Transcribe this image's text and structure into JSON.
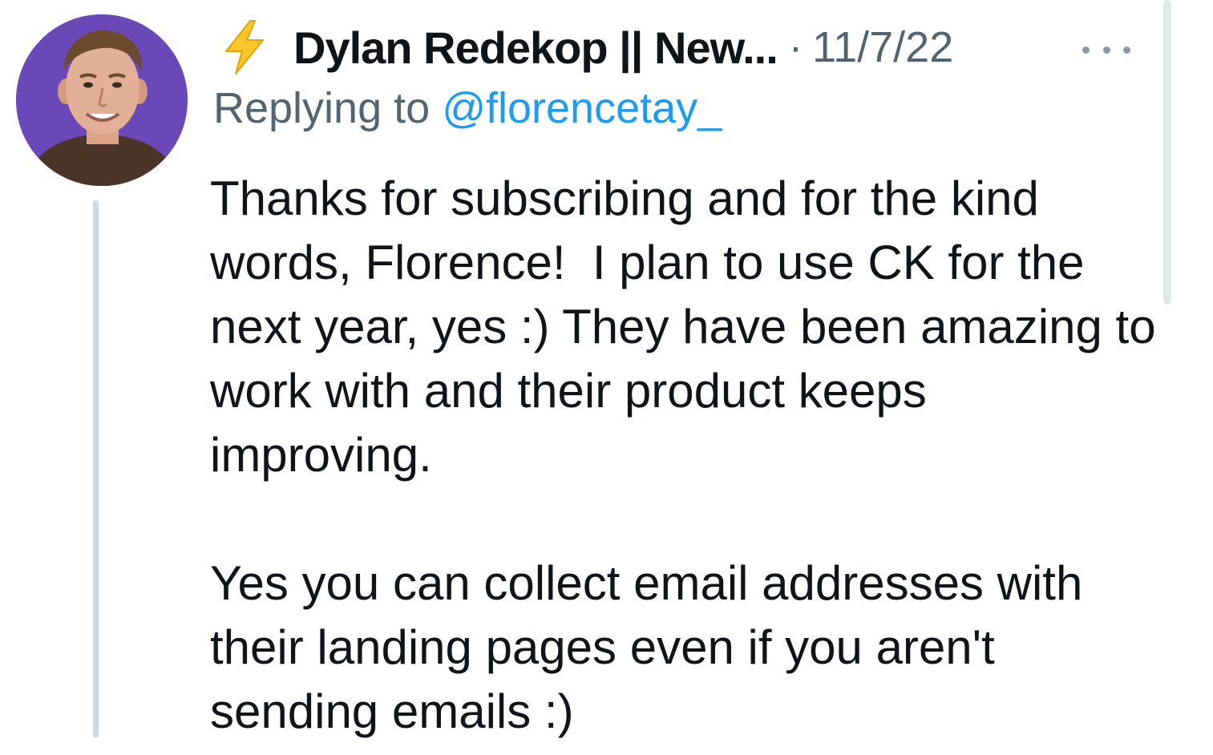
{
  "tweet": {
    "author_display_name": "Dylan Redekop || New...",
    "separator": "·",
    "date": "11/7/22",
    "replying_prefix": "Replying to",
    "replying_handle": "@florencetay_",
    "body_paragraphs": [
      "Thanks for subscribing and for the kind words, Florence!  I plan to use CK for the next year, yes :) They have been amazing to work with and their product keeps improving.",
      "Yes you can collect email addresses with their landing pages even if you aren't sending emails :)"
    ]
  },
  "icons": {
    "name_prefix": "lightning-bolt-icon",
    "overflow_menu": "more-horizontal-icon",
    "avatar": "profile-photo"
  },
  "colors": {
    "mention": "#1d9bf0",
    "secondary_text": "#536471",
    "avatar_background": "#6b48b8",
    "thread_line": "#cfd9de",
    "bolt_fill": "#f9c72a"
  }
}
